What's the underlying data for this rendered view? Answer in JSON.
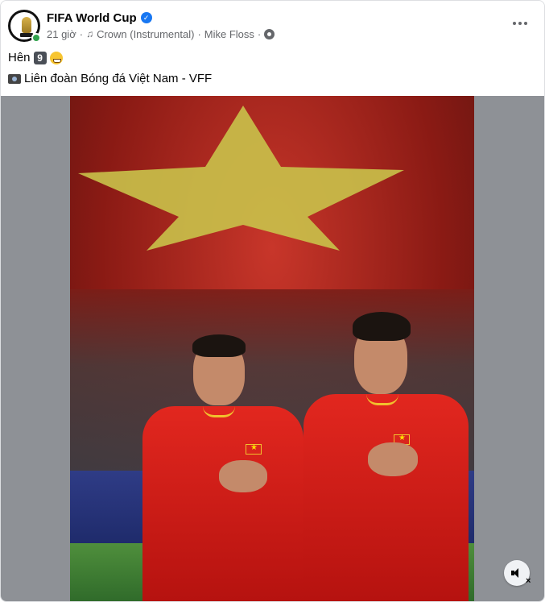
{
  "post": {
    "page_name": "FIFA World Cup",
    "verified": true,
    "time": "21 giờ",
    "separator": "·",
    "music": "Crown (Instrumental)",
    "artist": "Mike Floss",
    "caption_text": "Hên",
    "caption_badge": "9",
    "credit": "Liên đoàn Bóng đá Việt Nam - VFF",
    "icons": {
      "avatar": "fifa-world-cup-logo",
      "verified": "verified-badge-icon",
      "music": "music-note-icon",
      "audience": "gear-icon",
      "more": "more-options-icon",
      "emoji": "grinning-face-icon",
      "camera": "camera-icon",
      "mute": "speaker-muted-icon"
    },
    "colors": {
      "online": "#31a24c",
      "verified": "#1877f2",
      "muted_text": "#65676b",
      "media_background": "#8e9196"
    }
  }
}
